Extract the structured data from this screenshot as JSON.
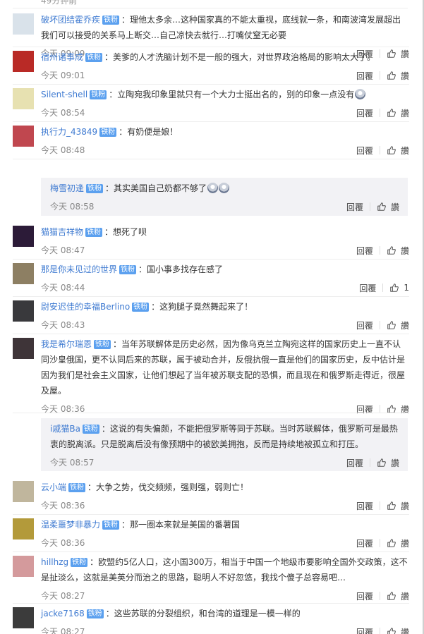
{
  "top_time": "49分钟前",
  "reply_label": "回覆",
  "like_label": "讚",
  "fan_badge": "铁粉",
  "comments": [
    {
      "user": "破坏团结霍乔疾",
      "text": "：理他太多余…这种国家真的不能太重视，底线就一条，和南波湾发展超出我们可以接受的关系马上断交…自己凉快去就行…打嘴仗窒无必要",
      "time": "今天 09:09"
    },
    {
      "user": "宿州诸事成",
      "text": "：美爹的人才洗脑计划不是一般的强大，对世界政治格局的影响太大了。",
      "time": "今天 09:01"
    },
    {
      "user": "Silent-shell",
      "text": "：立陶宛我印象里就只有一个大力士挺出名的，别的印象一点没有",
      "time": "今天 08:54"
    },
    {
      "user": "执行力_43849",
      "text": "：有奶便是娘！",
      "time": "今天 08:48"
    },
    {
      "user": "梅雪初逢",
      "text": "：其实美国自己奶都不够了",
      "time": "今天 08:58"
    },
    {
      "user": "猫猫吉祥物",
      "text": "：想死了呗",
      "time": "今天 08:47"
    },
    {
      "user": "那是你未见过的世界",
      "text": "：国小事多找存在感了",
      "time": "今天 08:44",
      "likes": "1"
    },
    {
      "user": "尉安迟佳的幸福Berlino",
      "text": "：这狗腿子竟然舞起来了！",
      "time": "今天 08:43"
    },
    {
      "user": "我是希尔瑞恩",
      "text": "：当年苏联解体是历史必然，因为像乌克兰立陶宛这样的国家历史上一直不认同沙皇俄国，更不认同后来的苏联，属于被动合并，反俄抗俄一直是他们的国家历史，反中估计是因为我们是社会主义国家，让他们想起了当年被苏联支配的恐惧，而且现在和俄罗斯走得近，很屋及屋。",
      "time": "今天 08:36"
    },
    {
      "user": "i戚猫Ba",
      "text": "：这说的有失偏颇，不能把俄罗斯等同于苏联。当时苏联解体，俄罗斯可是最热衷的脱离派。只是脱离后没有像预期中的被欧美拥抱，反而是持续地被孤立和打压。",
      "time": "今天 08:57"
    },
    {
      "user": "云小端",
      "text": "：大争之势，伐交频频，强则强，弱则亡！",
      "time": "今天 08:36"
    },
    {
      "user": "温柔噩梦非暴力",
      "text": "：那一圈本来就是美国的番薯国",
      "time": "今天 08:36"
    },
    {
      "user": "hillhzg",
      "text": "：欧盟约5亿人口，这小国300万，相当于中国一个地级市要影响全国外交政策，这不是扯淡么，这就是美英分而治之的思路，聪明人不好忽悠，我找个傻子总容易吧…",
      "time": "今天 08:27"
    },
    {
      "user": "jacke7168",
      "text": "：这些苏联的分裂组织，和台湾的道理是一模一样的",
      "time": "今天 08:27"
    }
  ]
}
